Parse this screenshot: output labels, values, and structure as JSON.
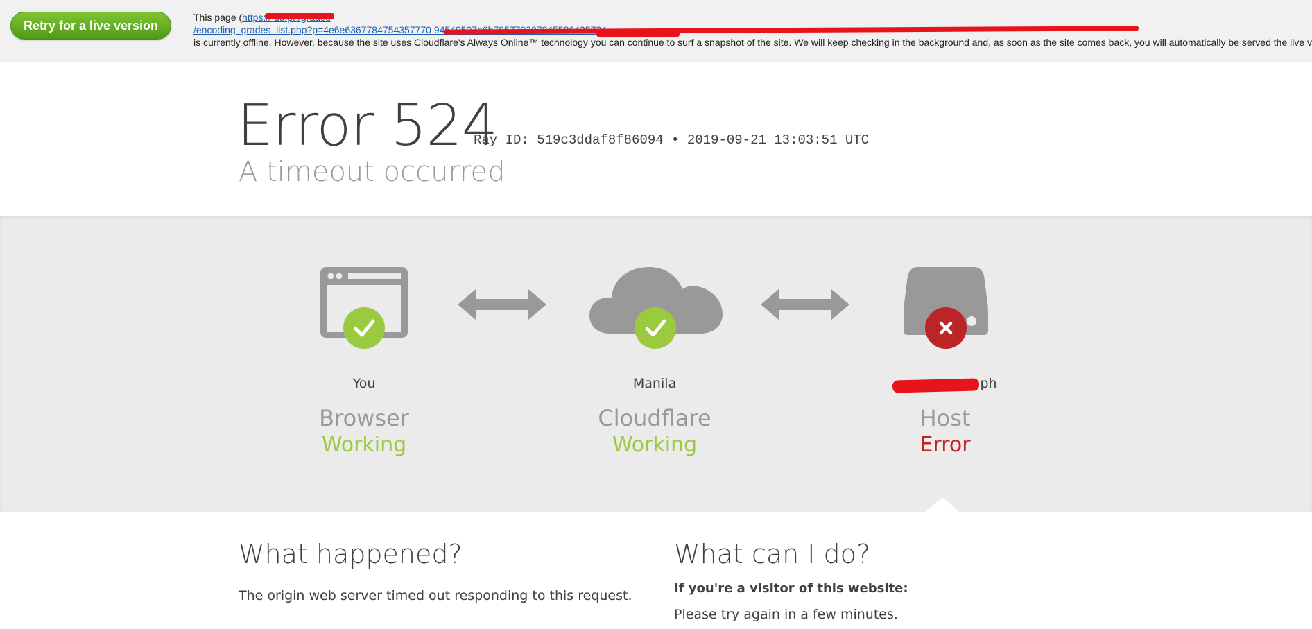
{
  "banner": {
    "retry_label": "Retry for a live version",
    "this_page_prefix": "This page (",
    "url_line1": "https://                   du.ph/grades",
    "url_line2": "/encoding_grades_list.php?p=4e6e6367784754357770                                                                                   94549507a6b785779387945586435734",
    "offline_message": "is currently offline. However, because the site uses Cloudflare's Always Online™ technology you can continue to surf a snapshot of the site. We will keep checking in the background and, as soon as the site comes back, you will automatically be served the live version."
  },
  "header": {
    "error_code": "Error 524",
    "ray_info": "Ray ID: 519c3ddaf8f86094 • 2019-09-21 13:03:51 UTC",
    "error_title": "A timeout occurred"
  },
  "diagram": {
    "browser": {
      "location": "You",
      "name": "Browser",
      "status": "Working",
      "icon": "browser-window-icon",
      "badge": "check-icon"
    },
    "cloudflare": {
      "location": "Manila",
      "name": "Cloudflare",
      "status": "Working",
      "icon": "cloud-icon",
      "badge": "check-icon"
    },
    "host": {
      "location": "ph",
      "name": "Host",
      "status": "Error",
      "icon": "server-icon",
      "badge": "x-icon"
    },
    "colors": {
      "working": "#9bca3e",
      "error": "#bd2426",
      "icon_gray": "#999999"
    }
  },
  "bottom": {
    "what_happened_title": "What happened?",
    "what_happened_text": "The origin web server timed out responding to this request.",
    "what_can_i_do_title": "What can I do?",
    "visitor_heading": "If you're a visitor of this website:",
    "visitor_text": "Please try again in a few minutes."
  }
}
